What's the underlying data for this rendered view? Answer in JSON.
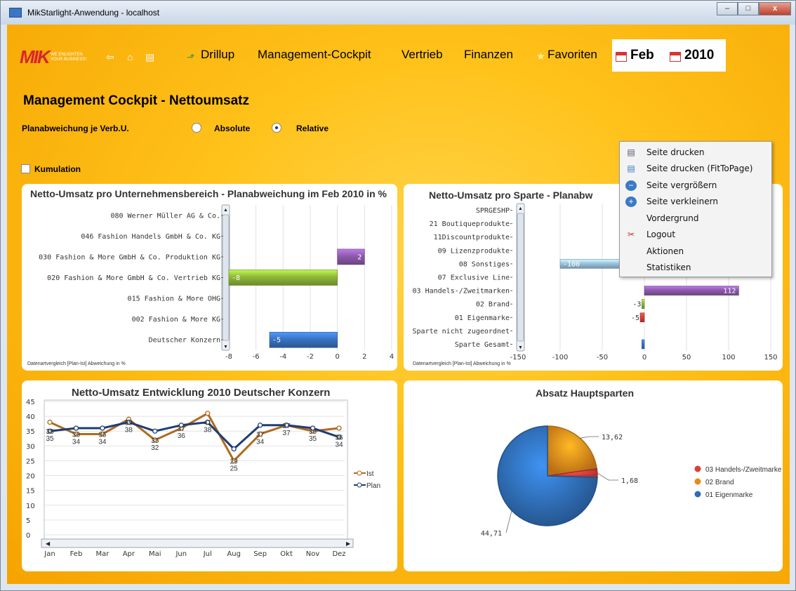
{
  "window": {
    "title": "MikStarlight-Anwendung - localhost",
    "min": "–",
    "max": "□",
    "close": "x"
  },
  "logo": {
    "text": "MIK",
    "tagline": "WE ENLIGHTEN YOUR BUSINESS!"
  },
  "nav": {
    "items": [
      "Drillup",
      "Management-Cockpit",
      "Vertrieb",
      "Finanzen",
      "Favoriten"
    ],
    "month": "Feb",
    "year": "2010"
  },
  "page": {
    "title": "Management Cockpit - Nettoumsatz",
    "filter_label": "Planabweichung je Verb.U.",
    "radio_absolute": "Absolute",
    "radio_relative": "Relative",
    "selected": "Relative",
    "kumulation": "Kumulation"
  },
  "chart_footer": "Datenartvergleich  [Plan-Ist]  Abweichung in %",
  "menu": {
    "items": [
      "Seite drucken",
      "Seite drucken (FitToPage)",
      "Seite vergrößern",
      "Seite verkleinern",
      "Vordergrund",
      "Logout",
      "Aktionen",
      "Statistiken"
    ],
    "icons": [
      "printer-icon",
      "printer-fit-icon",
      "zoom-in-icon",
      "zoom-out-icon",
      "",
      "scissors-icon",
      "",
      ""
    ]
  },
  "chart_data": [
    {
      "type": "bar",
      "orientation": "horizontal",
      "title": "Netto-Umsatz pro Unternehmensbereich  - Planabweichung im Feb 2010 in %",
      "categories": [
        "080 Werner Müller AG & Co.",
        "046 Fashion Handels GmbH & Co. KG",
        "030 Fashion & More GmbH & Co. Produktion KG",
        "020 Fashion & More GmbH & Co. Vertrieb KG",
        "015 Fashion & More OHG",
        "002 Fashion & More KG",
        "Deutscher Konzern"
      ],
      "values": [
        null,
        null,
        2,
        -8,
        null,
        null,
        -5
      ],
      "labels": [
        "",
        "",
        "2",
        "-8",
        "",
        "",
        "-5"
      ],
      "colors": [
        "",
        "",
        "#8e5aad",
        "#8fb83a",
        "",
        "",
        "#3a73c4"
      ],
      "xlim": [
        -8,
        4
      ],
      "xticks": [
        "-8",
        "-6",
        "-4",
        "-2",
        "0",
        "2",
        "4"
      ],
      "grid": true
    },
    {
      "type": "bar",
      "orientation": "horizontal",
      "title": "Netto-Umsatz pro Sparte  - Planabw",
      "categories": [
        "SPRGESHP",
        "21 Boutiqueprodukte",
        "11Discountprodukte",
        "09 Lizenzprodukte",
        "08 Sonstiges",
        "07 Exclusive Line",
        "03 Handels-/Zweitmarken",
        "02 Brand",
        "01 Eigenmarke",
        "Sparte nicht zugeordnet",
        "Sparte Gesamt"
      ],
      "values": [
        null,
        null,
        null,
        null,
        -100,
        null,
        112,
        -3,
        -5,
        null,
        -3
      ],
      "labels": [
        "",
        "",
        "",
        "",
        "-100",
        "",
        "112",
        "-3",
        "-5",
        "",
        ""
      ],
      "colors": [
        "",
        "",
        "",
        "",
        "#9cc3de",
        "",
        "#8e5aad",
        "#8fb83a",
        "#d9403b",
        "",
        "#3a73c4"
      ],
      "xlim": [
        -150,
        150
      ],
      "xticks": [
        "-150",
        "-100",
        "-50",
        "0",
        "50",
        "100",
        "150"
      ],
      "grid": true
    },
    {
      "type": "line",
      "title": "Netto-Umsatz Entwicklung 2010 Deutscher Konzern",
      "x": [
        "Jan",
        "Feb",
        "Mar",
        "Apr",
        "Mai",
        "Jun",
        "Jul",
        "Aug",
        "Sep",
        "Okt",
        "Nov",
        "Dez"
      ],
      "series": [
        {
          "name": "Ist",
          "color": "#b06a1e",
          "values": [
            38,
            34,
            34,
            39,
            32,
            36,
            41,
            25,
            34,
            37,
            35,
            36
          ],
          "labels": [
            "35",
            "34",
            "34",
            "38",
            "32",
            "36",
            "38",
            "25",
            "34",
            "37",
            "35",
            "34"
          ]
        },
        {
          "name": "Plan",
          "color": "#1f3d73",
          "values": [
            35,
            36,
            36,
            38,
            35,
            37,
            38,
            29,
            37,
            37,
            36,
            33
          ],
          "labels": [
            "38",
            "36",
            "36",
            "39",
            "35",
            "37",
            "41",
            "29",
            "37",
            "37",
            "36",
            "36"
          ]
        }
      ],
      "ylim": [
        0,
        45
      ],
      "yticks": [
        "0",
        "5",
        "10",
        "15",
        "20",
        "25",
        "30",
        "35",
        "40",
        "45"
      ],
      "grid": true,
      "legend": "right"
    },
    {
      "type": "pie",
      "title": "Absatz Hauptsparten",
      "categories": [
        "03 Handels-/Zweitmarke",
        "02 Brand",
        "01 Eigenmarke"
      ],
      "values": [
        1.68,
        13.62,
        44.71
      ],
      "labels": [
        "1,68",
        "13,62",
        "44,71"
      ],
      "colors": [
        "#d9403b",
        "#e88a1a",
        "#2f6db5"
      ],
      "legend": "right"
    }
  ]
}
